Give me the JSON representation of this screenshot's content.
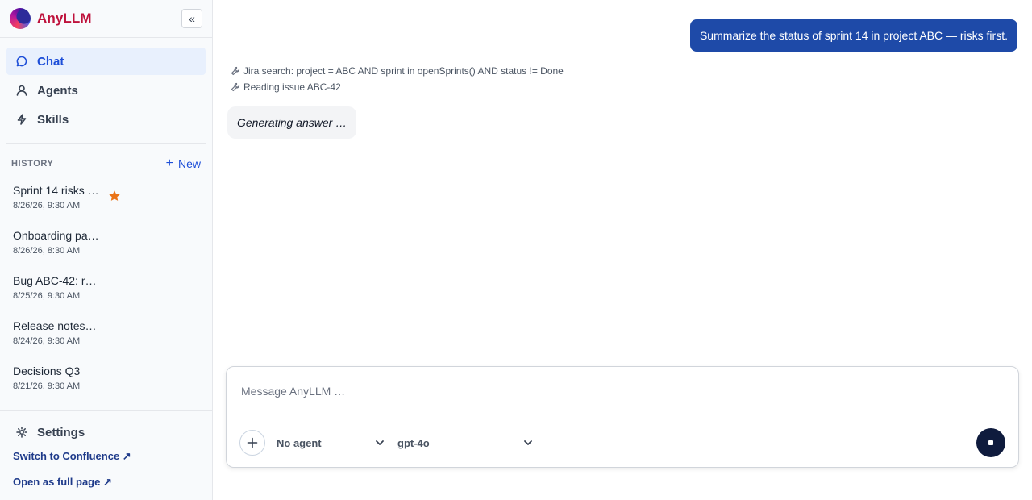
{
  "brand": {
    "name": "AnyLLM",
    "collapse_label": "«"
  },
  "nav": [
    {
      "label": "Chat",
      "icon": "chat-bubble-icon",
      "active": true
    },
    {
      "label": "Agents",
      "icon": "person-icon",
      "active": false
    },
    {
      "label": "Skills",
      "icon": "lightning-icon",
      "active": false
    }
  ],
  "history": {
    "title": "HISTORY",
    "new_label": "New",
    "items": [
      {
        "title": "Sprint 14 risks …",
        "date": "8/26/26, 9:30 AM",
        "starred": true
      },
      {
        "title": "Onboarding pa…",
        "date": "8/26/26, 8:30 AM",
        "starred": false
      },
      {
        "title": "Bug ABC-42: r…",
        "date": "8/25/26, 9:30 AM",
        "starred": false
      },
      {
        "title": "Release notes…",
        "date": "8/24/26, 9:30 AM",
        "starred": false
      },
      {
        "title": "Decisions Q3",
        "date": "8/21/26, 9:30 AM",
        "starred": false
      }
    ]
  },
  "footer": {
    "settings_label": "Settings",
    "confluence_link": "Switch to Confluence ↗",
    "fullpage_link": "Open as full page ↗"
  },
  "conversation": {
    "user_message": "Summarize the status of sprint 14 in project ABC — risks first.",
    "tool_calls": [
      "Jira search: project = ABC AND sprint in openSprints() AND status != Done",
      "Reading issue ABC-42"
    ],
    "status": "Generating answer …"
  },
  "composer": {
    "placeholder": "Message AnyLLM …",
    "value": "",
    "agent_select": "No agent",
    "model_select": "gpt-4o"
  },
  "colors": {
    "brand": "#be123c",
    "accent": "#1d4ed8",
    "user_bubble": "#1e4aa8",
    "star": "#ea7317",
    "stop_button": "#0f1b3d"
  }
}
